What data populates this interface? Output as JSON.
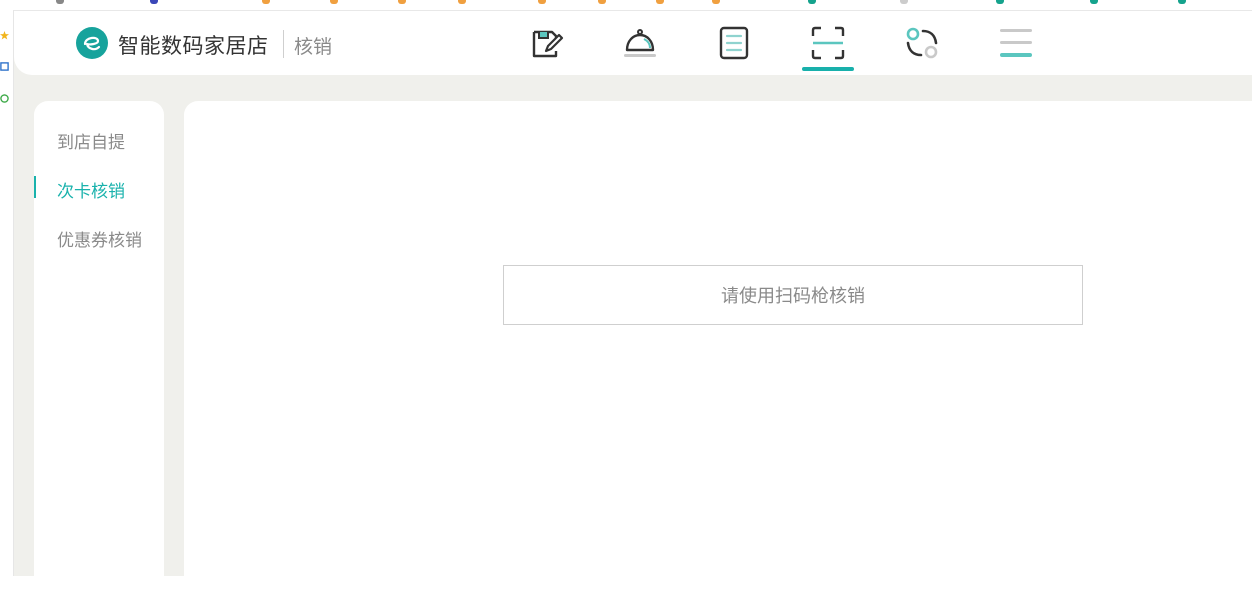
{
  "header": {
    "store_name": "智能数码家居店",
    "page_label": "核销"
  },
  "nav": {
    "active": "scan",
    "accent": "#18b0ab",
    "items": [
      {
        "icon": "edit-note-icon"
      },
      {
        "icon": "service-bell-icon"
      },
      {
        "icon": "document-list-icon"
      },
      {
        "icon": "scan-frame-icon"
      },
      {
        "icon": "toggle-circles-icon"
      },
      {
        "icon": "menu-lines-icon"
      }
    ]
  },
  "sidebar": {
    "items": [
      {
        "label": "到店自提",
        "active": false
      },
      {
        "label": "次卡核销",
        "active": true
      },
      {
        "label": "优惠券核销",
        "active": false
      }
    ]
  },
  "main": {
    "scan_prompt": "请使用扫码枪核销"
  },
  "colors": {
    "accent": "#19b2ac",
    "logo": "#17a39c",
    "background": "#f0f0ec"
  }
}
